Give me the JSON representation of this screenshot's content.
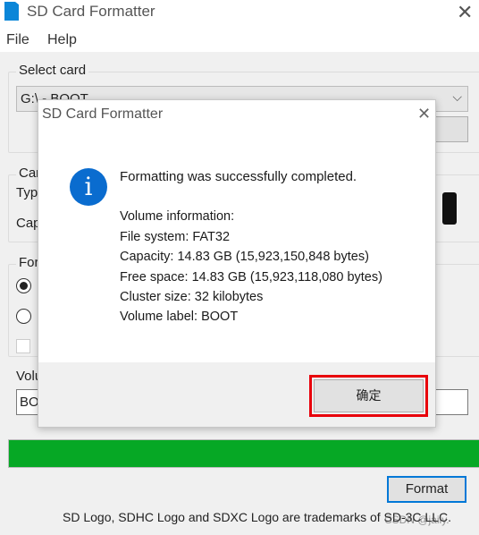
{
  "window": {
    "title": "SD Card Formatter",
    "close_icon": "close-icon"
  },
  "menu": {
    "items": [
      {
        "label": "File"
      },
      {
        "label": "Help"
      }
    ]
  },
  "select_card": {
    "label": "Select card",
    "selected": "G:\\ - BOOT"
  },
  "card_info": {
    "label": "Car",
    "type_label": "Typ",
    "capacity_label": "Cap"
  },
  "format_options": {
    "label": "For",
    "radio_1_checked": true,
    "radio_2_checked": false,
    "checkbox_checked": false,
    "volume_label": "Volu",
    "volume_value": "BO"
  },
  "progress": {
    "percent": 100,
    "color": "#06a825"
  },
  "format_button": "Format",
  "footer_text": "SD Logo, SDHC Logo and SDXC Logo are trademarks of SD-3C LLC.",
  "watermark": "CSDN @jaily.",
  "dialog": {
    "title": "SD Card Formatter",
    "icon": "info-icon",
    "message": "Formatting was successfully completed.",
    "lines": [
      "Volume information:",
      "File system: FAT32",
      "Capacity: 14.83 GB (15,923,150,848 bytes)",
      "Free space: 14.83 GB (15,923,118,080 bytes)",
      "Cluster size: 32 kilobytes",
      "Volume label: BOOT"
    ],
    "ok_label": "确定",
    "highlight_color": "#e8000b"
  }
}
